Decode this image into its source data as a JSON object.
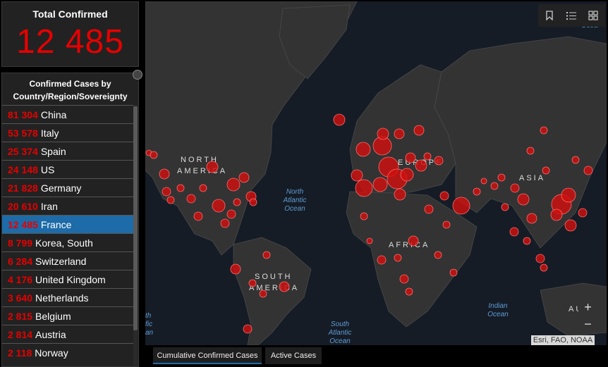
{
  "total": {
    "title": "Total Confirmed",
    "value": "12 485"
  },
  "list": {
    "title_line1": "Confirmed Cases by",
    "title_line2": "Country/Region/Sovereignty",
    "items": [
      {
        "value": "81 304",
        "name": "China"
      },
      {
        "value": "53 578",
        "name": "Italy"
      },
      {
        "value": "25 374",
        "name": "Spain"
      },
      {
        "value": "24 148",
        "name": "US"
      },
      {
        "value": "21 828",
        "name": "Germany"
      },
      {
        "value": "20 610",
        "name": "Iran"
      },
      {
        "value": "12 485",
        "name": "France",
        "selected": true
      },
      {
        "value": "8 799",
        "name": "Korea, South"
      },
      {
        "value": "6 284",
        "name": "Switzerland"
      },
      {
        "value": "4 176",
        "name": "United Kingdom"
      },
      {
        "value": "3 640",
        "name": "Netherlands"
      },
      {
        "value": "2 815",
        "name": "Belgium"
      },
      {
        "value": "2 814",
        "name": "Austria"
      },
      {
        "value": "2 118",
        "name": "Norway"
      }
    ]
  },
  "map": {
    "labels": {
      "north_america_1": "NORTH",
      "north_america_2": "AMERICA",
      "south_america_1": "SOUTH",
      "south_america_2": "AMERICA",
      "europe": "EUROPE",
      "asia": "ASIA",
      "africa": "AFRICA",
      "australia": "AU",
      "north_atlantic_1": "North",
      "north_atlantic_2": "Atlantic",
      "north_atlantic_3": "Ocean",
      "south_atlantic_1": "South",
      "south_atlantic_2": "Atlantic",
      "south_atlantic_3": "Ocean",
      "indian_1": "Indian",
      "indian_2": "Ocean",
      "pacific_left_1": "th",
      "pacific_left_2": "fic",
      "pacific_left_3": "an",
      "pacific_right": "Ocea"
    },
    "attribution": "Esri, FAO, NOAA",
    "zoom_in": "+",
    "zoom_out": "−",
    "toolbar": {
      "bookmark_icon": "bookmark-icon",
      "legend_icon": "legend-list-icon",
      "basemap_icon": "basemap-gallery-icon"
    }
  },
  "tabs": {
    "cumulative": "Cumulative Confirmed Cases",
    "active": "Active Cases"
  },
  "colors": {
    "accent_red": "#e60000",
    "selected_blue": "#1d6ba8"
  }
}
